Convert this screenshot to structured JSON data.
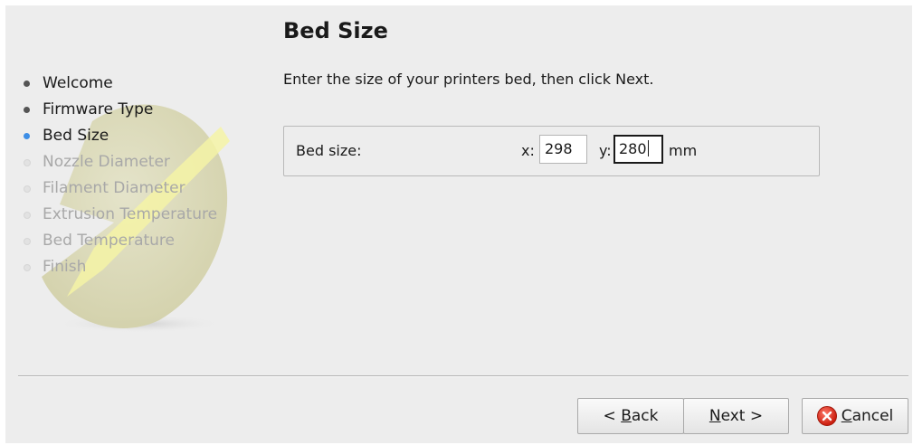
{
  "steps": [
    {
      "label": "Welcome",
      "state": "done"
    },
    {
      "label": "Firmware Type",
      "state": "done"
    },
    {
      "label": "Bed Size",
      "state": "current"
    },
    {
      "label": "Nozzle Diameter",
      "state": "pending"
    },
    {
      "label": "Filament Diameter",
      "state": "pending"
    },
    {
      "label": "Extrusion Temperature",
      "state": "pending"
    },
    {
      "label": "Bed Temperature",
      "state": "pending"
    },
    {
      "label": "Finish",
      "state": "pending"
    }
  ],
  "page": {
    "title": "Bed Size",
    "instruction": "Enter the size of your printers bed, then click Next."
  },
  "bed_size": {
    "label": "Bed size:",
    "x_label": "x:",
    "x_value": "298",
    "y_label": "y:",
    "y_value": "280",
    "unit": "mm"
  },
  "buttons": {
    "back_prefix": "< ",
    "back_mnemonic": "B",
    "back_rest": "ack",
    "next_mnemonic": "N",
    "next_rest": "ext >",
    "cancel_mnemonic": "C",
    "cancel_rest": "ancel"
  },
  "colors": {
    "dialog_bg": "#ededed",
    "current_step_bullet": "#3d8ee6",
    "pending_text": "#a8a8a8",
    "cancel_icon": "#cc1f10"
  },
  "icons": {
    "logo": "slic3r-logo-watermark",
    "cancel": "cancel-icon"
  }
}
